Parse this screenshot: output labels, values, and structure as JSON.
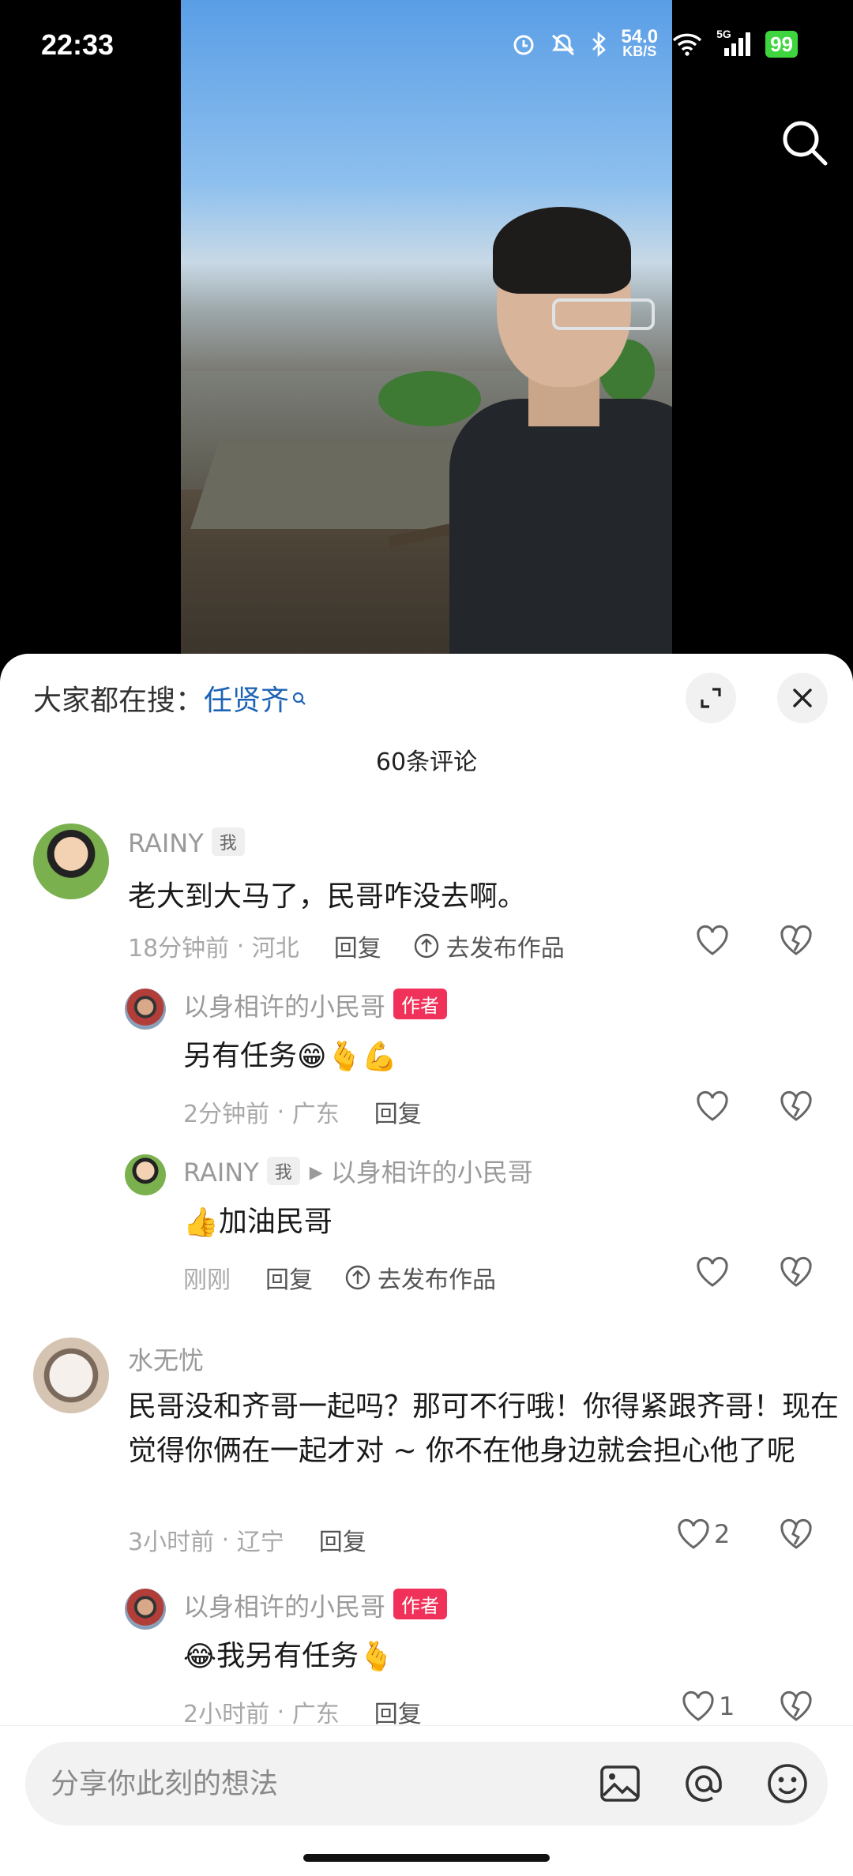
{
  "status_bar": {
    "time": "22:33",
    "net_speed_value": "54.0",
    "net_speed_unit": "KB/S",
    "signal_label": "5G",
    "battery": "99"
  },
  "video": {
    "search_icon": "search-icon"
  },
  "sheet": {
    "hot_search_prefix": "大家都在搜：",
    "hot_search_term": "任贤齐",
    "comment_count_title": "60条评论"
  },
  "comments": [
    {
      "name": "RAINY",
      "me_tag": "我",
      "text": "老大到大马了，民哥咋没去啊。",
      "time": "18分钟前",
      "location": "河北",
      "reply": "回复",
      "publish": "去发布作品",
      "replies": [
        {
          "name": "以身相许的小民哥",
          "author_tag": "作者",
          "text": "另有任务",
          "emojis": "😁🫰💪",
          "time": "2分钟前",
          "location": "广东",
          "reply": "回复"
        },
        {
          "name": "RAINY",
          "me_tag": "我",
          "reply_to": "以身相许的小民哥",
          "emoji_lead": "👍",
          "text": "加油民哥",
          "time": "刚刚",
          "reply": "回复",
          "publish": "去发布作品"
        }
      ]
    },
    {
      "name": "水无忧",
      "text": "民哥没和齐哥一起吗？那可不行哦！你得紧跟齐哥！现在觉得你俩在一起才对 ~ 你不在他身边就会担心他了呢",
      "time": "3小时前",
      "location": "辽宁",
      "reply": "回复",
      "likes": "2",
      "replies": [
        {
          "name": "以身相许的小民哥",
          "author_tag": "作者",
          "emoji_lead": "😂",
          "text": "我另有任务",
          "emojis": "🫰",
          "time": "2小时前",
          "location": "广东",
          "reply": "回复",
          "likes": "1"
        }
      ]
    }
  ],
  "input": {
    "placeholder": "分享你此刻的想法"
  },
  "colors": {
    "accent_link": "#1e64b4",
    "author_tag": "#f0325a",
    "battery": "#3ed53e"
  }
}
